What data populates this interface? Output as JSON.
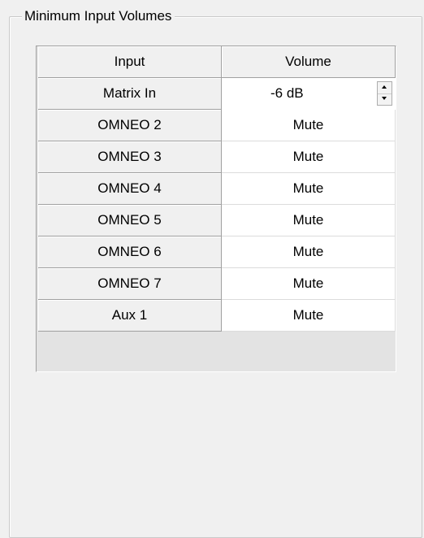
{
  "group": {
    "title": "Minimum Input Volumes"
  },
  "table": {
    "columns": [
      "Input",
      "Volume"
    ],
    "rows": [
      {
        "input": "Matrix In",
        "volume": "-6 dB",
        "editing": true
      },
      {
        "input": "OMNEO 2",
        "volume": "Mute"
      },
      {
        "input": "OMNEO 3",
        "volume": "Mute"
      },
      {
        "input": "OMNEO 4",
        "volume": "Mute"
      },
      {
        "input": "OMNEO 5",
        "volume": "Mute"
      },
      {
        "input": "OMNEO 6",
        "volume": "Mute"
      },
      {
        "input": "OMNEO 7",
        "volume": "Mute"
      },
      {
        "input": "Aux 1",
        "volume": "Mute"
      }
    ]
  },
  "icons": {
    "spin_up": "spin-up-arrow-icon",
    "spin_down": "spin-down-arrow-icon"
  }
}
